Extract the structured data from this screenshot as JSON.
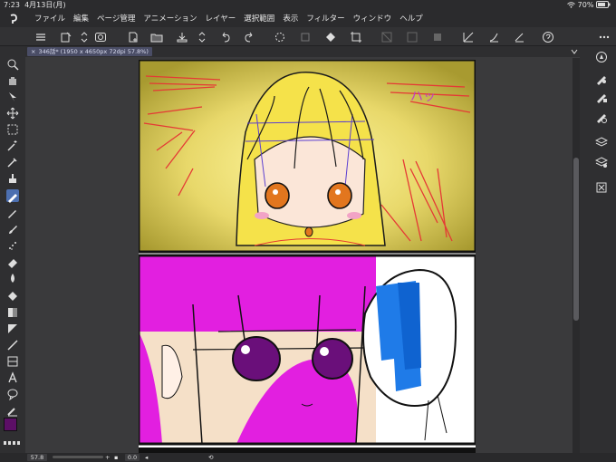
{
  "status": {
    "time": "7:23",
    "date": "4月13日(月)",
    "battery": "70%"
  },
  "menu": {
    "items": [
      "ファイル",
      "編集",
      "ページ管理",
      "アニメーション",
      "レイヤー",
      "選択範囲",
      "表示",
      "フィルター",
      "ウィンドウ",
      "ヘルプ"
    ]
  },
  "document": {
    "tab_label": "346話* (1950 x 4650px 72dpi 57.8%)"
  },
  "view": {
    "zoom": "57.8",
    "rotation": "0.0"
  },
  "colors": {
    "main_color": "#5c0f66",
    "sub_color": "#f7e6df",
    "accent": "#4c6fb0"
  },
  "comic": {
    "sfx_text": "ハッ"
  }
}
